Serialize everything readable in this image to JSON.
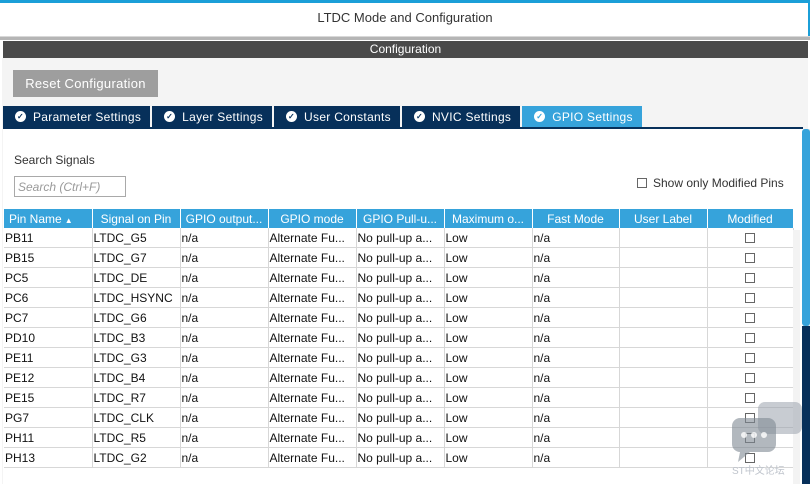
{
  "window": {
    "title": "LTDC Mode and Configuration"
  },
  "configuration": {
    "header": "Configuration",
    "reset_label": "Reset Configuration"
  },
  "tabs": [
    {
      "label": "Parameter Settings",
      "active": false
    },
    {
      "label": "Layer Settings",
      "active": false
    },
    {
      "label": "User Constants",
      "active": false
    },
    {
      "label": "NVIC Settings",
      "active": false
    },
    {
      "label": "GPIO Settings",
      "active": true
    }
  ],
  "search": {
    "label": "Search Signals",
    "placeholder": "Search (Ctrl+F)",
    "value": ""
  },
  "modified_only": {
    "label": "Show only Modified Pins",
    "checked": false
  },
  "table": {
    "columns": [
      "Pin Name",
      "Signal on Pin",
      "GPIO output...",
      "GPIO mode",
      "GPIO Pull-u...",
      "Maximum o...",
      "Fast Mode",
      "User Label",
      "Modified"
    ],
    "rows": [
      {
        "pin": "PB11",
        "signal": "LTDC_G5",
        "output": "n/a",
        "mode": "Alternate Fu...",
        "pull": "No pull-up a...",
        "speed": "Low",
        "fast": "n/a",
        "label": "",
        "modified": false
      },
      {
        "pin": "PB15",
        "signal": "LTDC_G7",
        "output": "n/a",
        "mode": "Alternate Fu...",
        "pull": "No pull-up a...",
        "speed": "Low",
        "fast": "n/a",
        "label": "",
        "modified": false
      },
      {
        "pin": "PC5",
        "signal": "LTDC_DE",
        "output": "n/a",
        "mode": "Alternate Fu...",
        "pull": "No pull-up a...",
        "speed": "Low",
        "fast": "n/a",
        "label": "",
        "modified": false
      },
      {
        "pin": "PC6",
        "signal": "LTDC_HSYNC",
        "output": "n/a",
        "mode": "Alternate Fu...",
        "pull": "No pull-up a...",
        "speed": "Low",
        "fast": "n/a",
        "label": "",
        "modified": false
      },
      {
        "pin": "PC7",
        "signal": "LTDC_G6",
        "output": "n/a",
        "mode": "Alternate Fu...",
        "pull": "No pull-up a...",
        "speed": "Low",
        "fast": "n/a",
        "label": "",
        "modified": false
      },
      {
        "pin": "PD10",
        "signal": "LTDC_B3",
        "output": "n/a",
        "mode": "Alternate Fu...",
        "pull": "No pull-up a...",
        "speed": "Low",
        "fast": "n/a",
        "label": "",
        "modified": false
      },
      {
        "pin": "PE11",
        "signal": "LTDC_G3",
        "output": "n/a",
        "mode": "Alternate Fu...",
        "pull": "No pull-up a...",
        "speed": "Low",
        "fast": "n/a",
        "label": "",
        "modified": false
      },
      {
        "pin": "PE12",
        "signal": "LTDC_B4",
        "output": "n/a",
        "mode": "Alternate Fu...",
        "pull": "No pull-up a...",
        "speed": "Low",
        "fast": "n/a",
        "label": "",
        "modified": false
      },
      {
        "pin": "PE15",
        "signal": "LTDC_R7",
        "output": "n/a",
        "mode": "Alternate Fu...",
        "pull": "No pull-up a...",
        "speed": "Low",
        "fast": "n/a",
        "label": "",
        "modified": false
      },
      {
        "pin": "PG7",
        "signal": "LTDC_CLK",
        "output": "n/a",
        "mode": "Alternate Fu...",
        "pull": "No pull-up a...",
        "speed": "Low",
        "fast": "n/a",
        "label": "",
        "modified": false
      },
      {
        "pin": "PH11",
        "signal": "LTDC_R5",
        "output": "n/a",
        "mode": "Alternate Fu...",
        "pull": "No pull-up a...",
        "speed": "Low",
        "fast": "n/a",
        "label": "",
        "modified": false
      },
      {
        "pin": "PH13",
        "signal": "LTDC_G2",
        "output": "n/a",
        "mode": "Alternate Fu...",
        "pull": "No pull-up a...",
        "speed": "Low",
        "fast": "n/a",
        "label": "",
        "modified": false
      }
    ]
  },
  "watermark": {
    "text": "ST中文论坛"
  },
  "colors": {
    "accent": "#36a3db",
    "tab_dark": "#07305a",
    "header_bar": "#4a4a4a",
    "button_gray": "#9e9e9e"
  }
}
